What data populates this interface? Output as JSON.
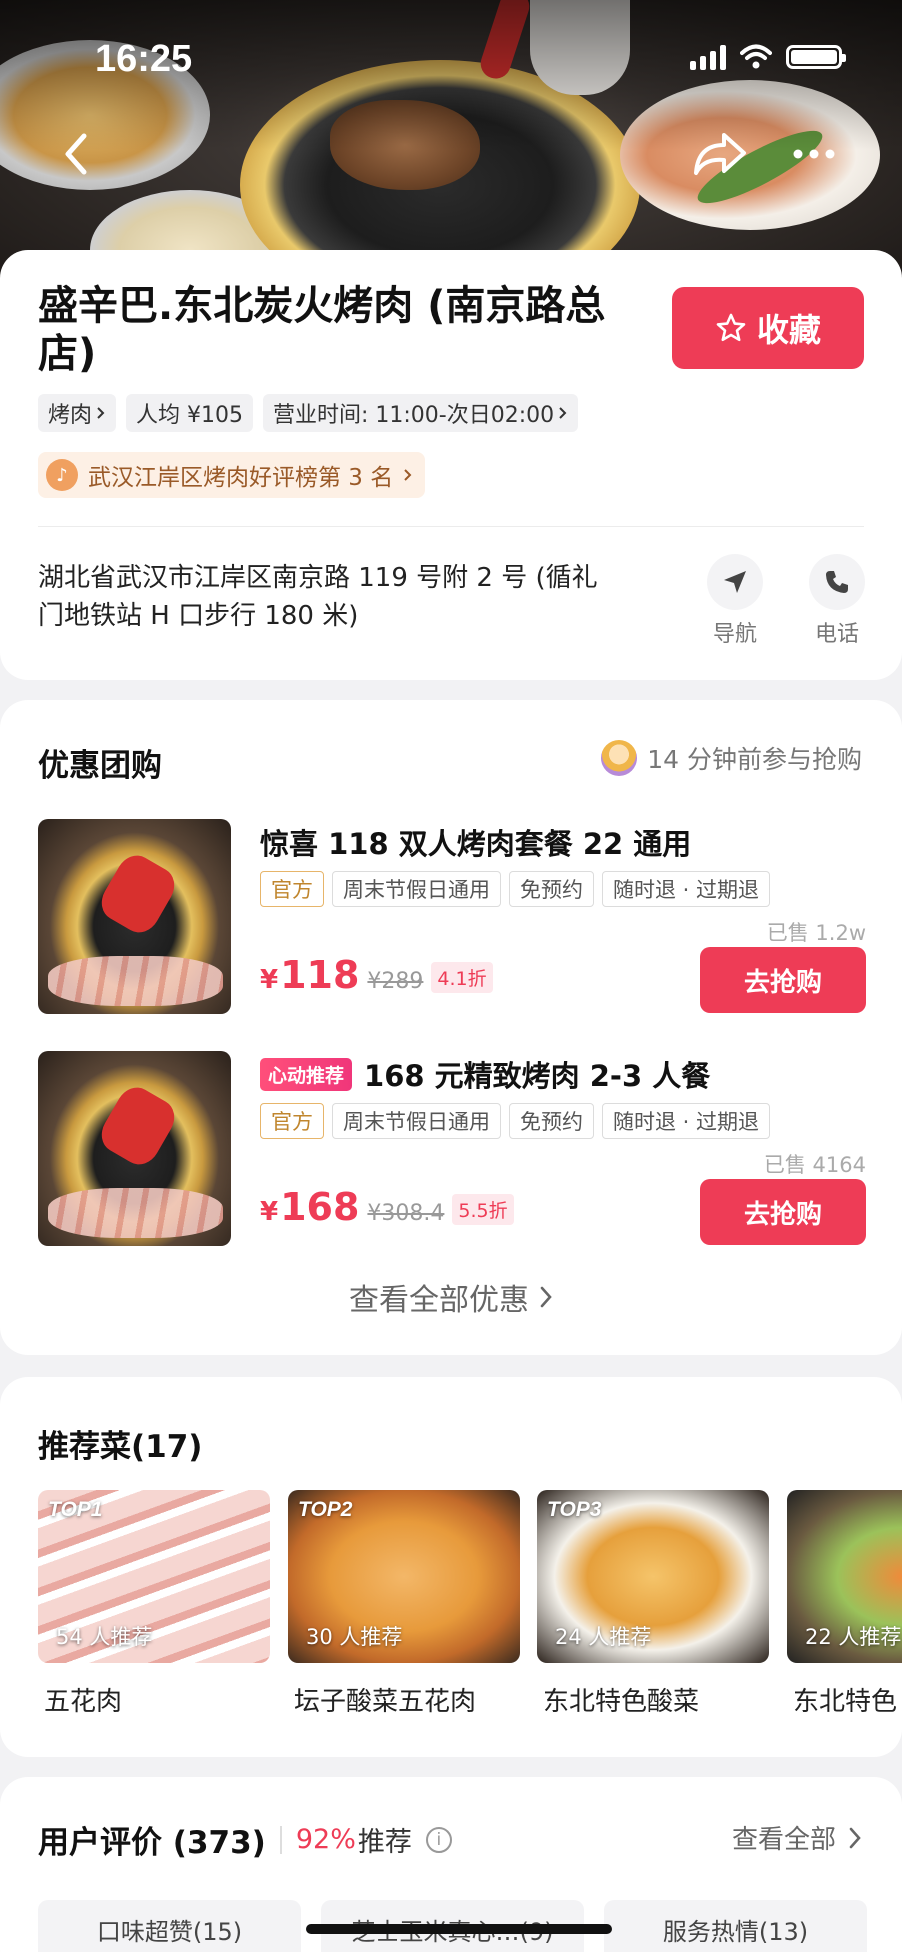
{
  "status": {
    "time": "16:25"
  },
  "shop": {
    "name": "盛辛巴.东北炭火烤肉 (南京路总店)",
    "favorite_label": "收藏",
    "tags": [
      {
        "label": "烤肉",
        "arrow": true
      },
      {
        "label": "人均 ¥105",
        "arrow": false
      },
      {
        "label": "营业时间: 11:00-次日02:00",
        "arrow": true
      }
    ],
    "rank": "武汉江岸区烤肉好评榜第 3 名",
    "address": "湖北省武汉市江岸区南京路 119 号附 2 号 (循礼门地铁站 H 口步行 180 米)",
    "nav_label": "导航",
    "phone_label": "电话"
  },
  "deals": {
    "title": "优惠团购",
    "recent": "14 分钟前参与抢购",
    "items": [
      {
        "badge": "",
        "title": "惊喜 118 双人烤肉套餐 22 通用",
        "tags": [
          "官方",
          "周末节假日通用",
          "免预约",
          "随时退 · 过期退"
        ],
        "sold": "已售 1.2w",
        "currency": "¥",
        "price": "118",
        "original": "¥289",
        "discount": "4.1折",
        "buy_label": "去抢购"
      },
      {
        "badge": "心动推荐",
        "title": "168 元精致烤肉 2-3 人餐",
        "tags": [
          "官方",
          "周末节假日通用",
          "免预约",
          "随时退 · 过期退"
        ],
        "sold": "已售 4164",
        "currency": "¥",
        "price": "168",
        "original": "¥308.4",
        "discount": "5.5折",
        "buy_label": "去抢购"
      }
    ],
    "view_all": "查看全部优惠"
  },
  "dishes": {
    "title": "推荐菜(17)",
    "items": [
      {
        "rank": "TOP1",
        "recommend": "54 人推荐",
        "name": "五花肉"
      },
      {
        "rank": "TOP2",
        "recommend": "30 人推荐",
        "name": "坛子酸菜五花肉"
      },
      {
        "rank": "TOP3",
        "recommend": "24 人推荐",
        "name": "东北特色酸菜"
      },
      {
        "rank": "",
        "recommend": "22 人推荐",
        "name": "东北特色"
      }
    ]
  },
  "reviews": {
    "title": "用户评价 (373)",
    "percent": "92%",
    "percent_label": "推荐",
    "info": "i",
    "see_all": "查看全部",
    "chips": [
      "口味超赞(15)",
      "芝士玉米真心…(9)",
      "服务热情(13)"
    ]
  },
  "colors": {
    "accent": "#ee3c56",
    "rank_text": "#9a5a28",
    "official": "#c0862e"
  },
  "icons": [
    "back-icon",
    "share-icon",
    "more-icon",
    "star-icon",
    "douyin-icon",
    "navigation-icon",
    "phone-icon",
    "chevron-right-icon",
    "info-icon"
  ]
}
